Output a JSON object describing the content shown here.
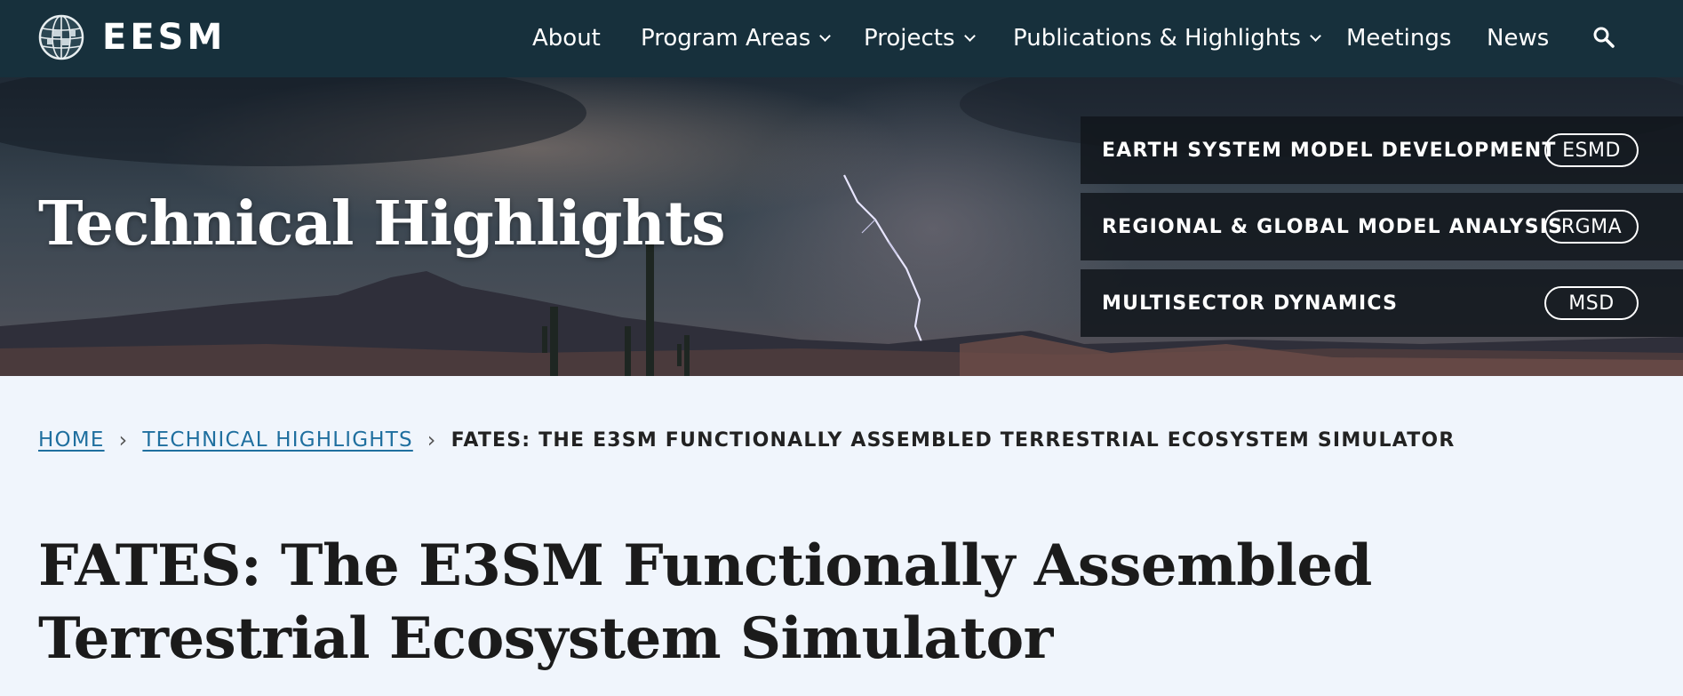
{
  "site": {
    "logo_text": "EESM"
  },
  "nav": {
    "items": [
      {
        "label": "About",
        "has_dropdown": false
      },
      {
        "label": "Program Areas",
        "has_dropdown": true
      },
      {
        "label": "Projects",
        "has_dropdown": true
      },
      {
        "label": "Publications & Highlights",
        "has_dropdown": true
      },
      {
        "label": "Meetings",
        "has_dropdown": false
      },
      {
        "label": "News",
        "has_dropdown": false
      }
    ],
    "search_icon": "search-icon"
  },
  "hero": {
    "title": "Technical Highlights",
    "programs": [
      {
        "name": "EARTH SYSTEM MODEL DEVELOPMENT",
        "badge": "ESMD"
      },
      {
        "name": "REGIONAL & GLOBAL MODEL ANALYSIS",
        "badge": "RGMA"
      },
      {
        "name": "MULTISECTOR DYNAMICS",
        "badge": "MSD"
      }
    ]
  },
  "breadcrumb": {
    "home": "HOME",
    "section": "TECHNICAL HIGHLIGHTS",
    "current": "FATES: THE E3SM FUNCTIONALLY ASSEMBLED TERRESTRIAL ECOSYSTEM SIMULATOR"
  },
  "page": {
    "title": "FATES: The E3SM Functionally Assembled Terrestrial Ecosystem Simulator"
  },
  "colors": {
    "nav_bg": "#17303c",
    "link": "#1f6f9f",
    "page_bg": "#f0f5fc",
    "card_bg": "#12161c"
  }
}
